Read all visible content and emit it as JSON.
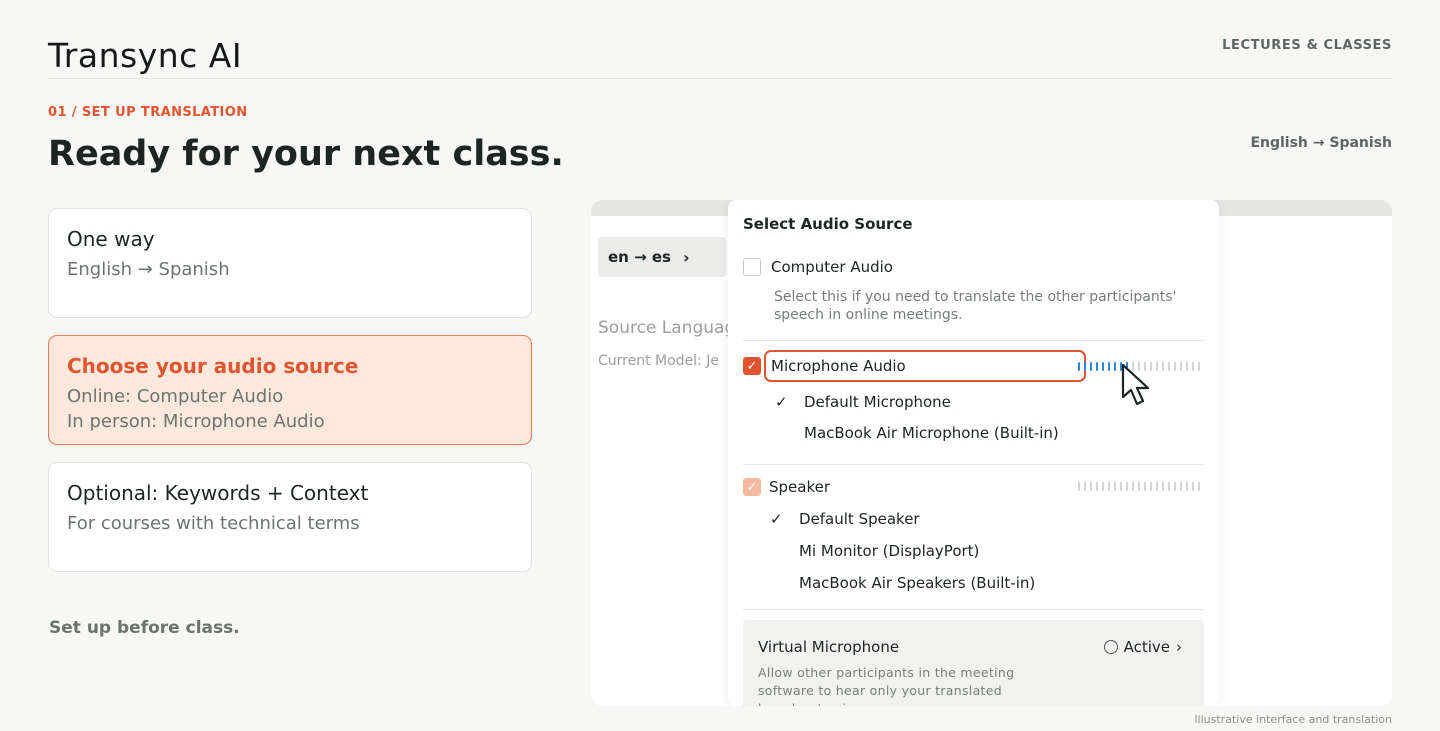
{
  "header": {
    "brand": "Transync AI",
    "nav_link": "LECTURES & CLASSES"
  },
  "hero": {
    "step_label": "01 / SET UP TRANSLATION",
    "headline": "Ready for your next class.",
    "language_pair": "English → Spanish"
  },
  "cards": [
    {
      "title": "One way",
      "lines": [
        "English → Spanish"
      ]
    },
    {
      "title": "Choose your audio source",
      "lines": [
        "Online: Computer Audio",
        "In person: Microphone Audio"
      ]
    },
    {
      "title": "Optional: Keywords + Context",
      "lines": [
        "For courses with technical terms"
      ]
    }
  ],
  "footnote": "Set up before class.",
  "caption": "Illustrative interface and translation",
  "app": {
    "lang_chip": "en → es",
    "source_language_label": "Source Languag",
    "current_model_label": "Current Model: Je",
    "panel": {
      "title": "Select Audio Source",
      "computer_audio": {
        "label": "Computer Audio",
        "description": "Select this if you need to translate the other participants' speech in online meetings."
      },
      "microphone_audio": {
        "label": "Microphone Audio",
        "options": [
          "Default Microphone",
          "MacBook Air Microphone (Built-in)"
        ],
        "level": 0.45
      },
      "speaker": {
        "label": "Speaker",
        "options": [
          "Default Speaker",
          "Mi Monitor (DisplayPort)",
          "MacBook Air Speakers (Built-in)"
        ],
        "level": 0
      },
      "virtual_microphone": {
        "title": "Virtual Microphone",
        "status": "Active",
        "description": "Allow other participants in the meeting software to hear only your translated broadcast voice."
      }
    }
  },
  "colors": {
    "accent": "#e0552f",
    "accent_bg": "#fce8dd",
    "meter_active": "#2d86d6"
  },
  "icons": [
    "arrow-right-icon",
    "chevron-right-icon",
    "checkmark-icon",
    "cursor-pointer-icon",
    "radio-icon"
  ]
}
